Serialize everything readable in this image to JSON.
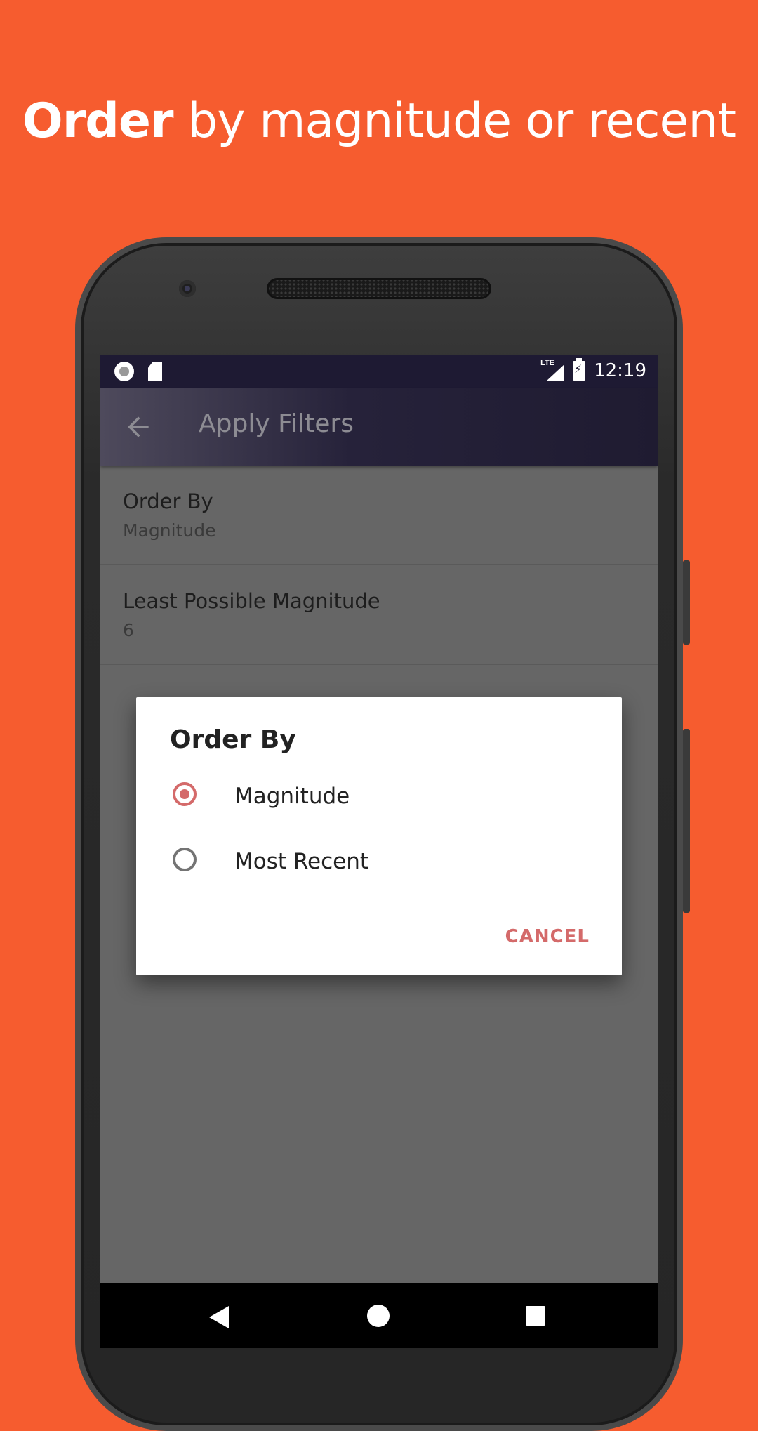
{
  "promo": {
    "headline_bold": "Order",
    "headline_rest": " by magnitude or recent",
    "background_color": "#F65C2F"
  },
  "status_bar": {
    "network": "LTE",
    "time": "12:19"
  },
  "toolbar": {
    "title": "Apply Filters",
    "back_icon": "arrow-back-icon"
  },
  "preferences": [
    {
      "title": "Order By",
      "summary": "Magnitude"
    },
    {
      "title": "Least Possible Magnitude",
      "summary": "6"
    }
  ],
  "dialog": {
    "title": "Order By",
    "options": [
      {
        "label": "Magnitude",
        "selected": true
      },
      {
        "label": "Most Recent",
        "selected": false
      }
    ],
    "cancel_label": "CANCEL",
    "accent_color": "#D46A6A"
  }
}
